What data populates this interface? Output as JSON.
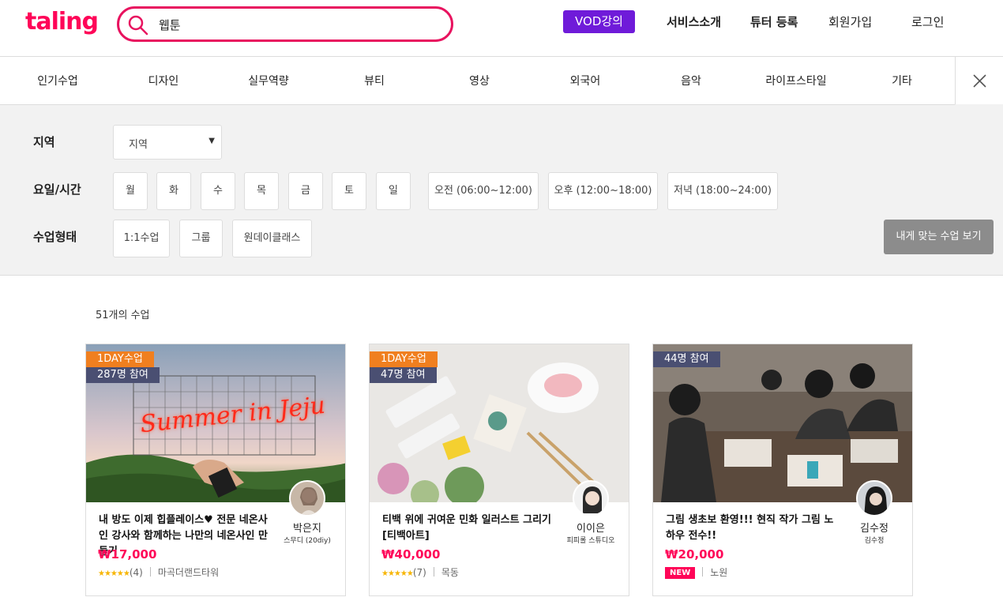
{
  "header": {
    "logo": "taling",
    "search_value": "웹툰",
    "vod_label": "VOD강의",
    "nav": [
      "서비스소개",
      "튜터 등록",
      "회원가입",
      "로그인"
    ]
  },
  "categories": [
    "인기수업",
    "디자인",
    "실무역량",
    "뷰티",
    "영상",
    "외국어",
    "음악",
    "라이프스타일",
    "기타"
  ],
  "filter": {
    "region_label": "지역",
    "region_value": "지역",
    "time_label": "요일/시간",
    "days": [
      "월",
      "화",
      "수",
      "목",
      "금",
      "토",
      "일"
    ],
    "times": [
      "오전 (06:00~12:00)",
      "오후 (12:00~18:00)",
      "저녁 (18:00~24:00)"
    ],
    "type_label": "수업형태",
    "types": [
      "1:1수업",
      "그룹",
      "원데이클래스"
    ],
    "match_button": "내게 맞는 수업 보기"
  },
  "results_count": "51개의 수업",
  "cards": [
    {
      "badge_day": "1DAY수업",
      "badge_count": "287명 참여",
      "title": "내 방도 이제 힙플레이스♥ 전문 네온사인 강사와 함께하는 나만의 네온사인 만들기",
      "tutor_name": "박은지",
      "tutor_studio": "스무디 (20diy)",
      "price": "₩17,000",
      "stars": "★★★★★",
      "reviews": "(4)",
      "location": "마곡더랜드타워",
      "thumb_text": "Summer in Jeju"
    },
    {
      "badge_day": "1DAY수업",
      "badge_count": "47명 참여",
      "title": "티백 위에 귀여운 민화 일러스트 그리기 [티백아트]",
      "tutor_name": "이이은",
      "tutor_studio": "피피롤 스튜디오",
      "price": "₩40,000",
      "stars": "★★★★★",
      "reviews": "(7)",
      "location": "목동"
    },
    {
      "badge_count": "44명 참여",
      "title": "그림 생초보 환영!!! 현직 작가 그림 노하우 전수!!",
      "tutor_name": "김수정",
      "tutor_studio": "김수정",
      "price": "₩20,000",
      "new_badge": "NEW",
      "location": "노원"
    }
  ],
  "colors": {
    "brand": "#ff0558",
    "vod": "#6f1bd9",
    "badge_orange": "#f07f1f",
    "badge_navy": "#4a4f72"
  }
}
